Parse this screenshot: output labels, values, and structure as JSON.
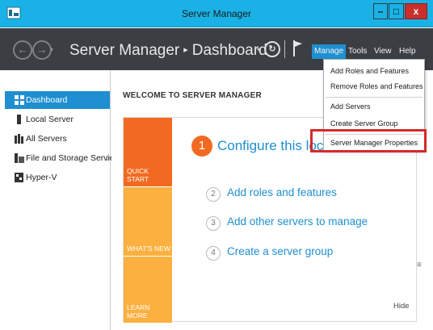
{
  "window": {
    "title": "Server Manager",
    "min_glyph": "–",
    "max_glyph": "□",
    "close_glyph": "x"
  },
  "toolbar": {
    "back_glyph": "←",
    "forward_glyph": "→",
    "dropdown_glyph": "▾",
    "breadcrumb_root": "Server Manager",
    "breadcrumb_sep": "▸",
    "breadcrumb_current": "Dashboard",
    "refresh_glyph": "↻",
    "menus": {
      "manage": "Manage",
      "tools": "Tools",
      "view": "View",
      "help": "Help"
    }
  },
  "sidebar": {
    "items": [
      {
        "label": "Dashboard",
        "icon": "dashboard-icon",
        "active": true
      },
      {
        "label": "Local Server",
        "icon": "server-icon",
        "active": false
      },
      {
        "label": "All Servers",
        "icon": "servers-icon",
        "active": false
      },
      {
        "label": "File and Storage Services",
        "icon": "storage-icon",
        "active": false,
        "expand_glyph": "▷"
      },
      {
        "label": "Hyper-V",
        "icon": "hyperv-icon",
        "active": false
      }
    ]
  },
  "main": {
    "welcome": "WELCOME TO SERVER MANAGER",
    "tiles": {
      "quick_start": "QUICK START",
      "whats_new": "WHAT'S NEW",
      "learn_more": "LEARN MORE"
    },
    "steps": [
      {
        "num": "1",
        "text": "Configure this local server"
      },
      {
        "num": "2",
        "text": "Add roles and features"
      },
      {
        "num": "3",
        "text": "Add other servers to manage"
      },
      {
        "num": "4",
        "text": "Create a server group"
      }
    ],
    "hide": "Hide",
    "scroll_grip": "≡"
  },
  "manage_menu": {
    "items": [
      "Add Roles and Features",
      "Remove Roles and Features",
      "Add Servers",
      "Create Server Group",
      "Server Manager Properties"
    ]
  },
  "colors": {
    "title_bar": "#1ab2e6",
    "toolbar": "#3b3e43",
    "accent_blue": "#1e8fd0",
    "quick_start_orange": "#f26a21",
    "tile_yellow": "#fbb040",
    "highlight_red": "#d42a2a"
  }
}
